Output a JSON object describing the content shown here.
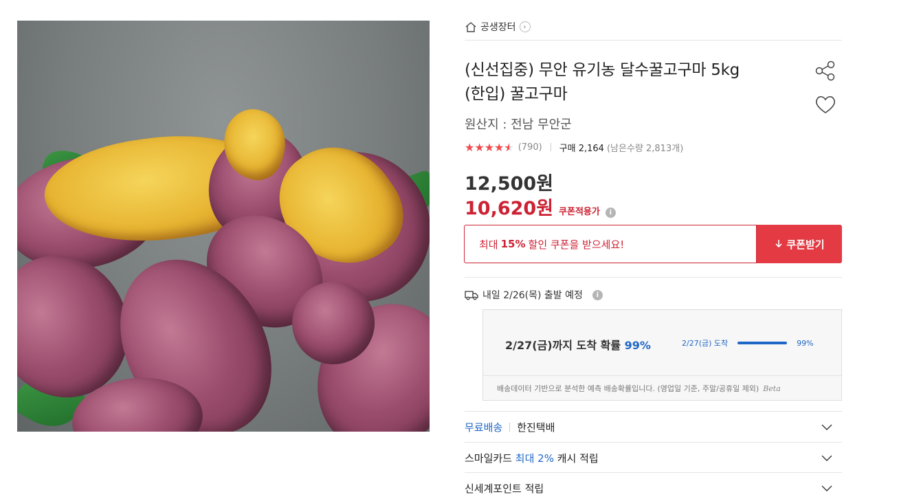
{
  "breadcrumb": {
    "label": "공생장터",
    "icon": "home-icon"
  },
  "product": {
    "title_line1": "(신선집중) 무안 유기농 달수꿀고구마 5kg",
    "title_line2": "(한입) 꿀고구마",
    "origin": "원산지 : 전남 무안군",
    "rating": 4.5,
    "rating_stars": "★★★★★",
    "review_count": "(790)",
    "purchases": "구매 2,164",
    "remaining": "(남은수량 2,813개)",
    "price": "12,500원",
    "sale_price": "10,620원",
    "coupon_applied_label": "쿠폰적용가"
  },
  "coupon": {
    "text_before": "최대",
    "percent": "15%",
    "text_after": "할인 쿠폰을 받으세요!",
    "button_label": "쿠폰받기"
  },
  "shipping": {
    "departure": "내일 2/26(목) 출발 예정",
    "arrival_headline": "2/27(금)까지 도착 확률",
    "arrival_pct": "99%",
    "mini_label": "2/27(금) 도착",
    "mini_pct": "99%",
    "mini_value": 0.99,
    "note": "배송데이터 기반으로 분석한 예측 배송확률입니다. (영업일 기준, 주말/공휴일 제외)",
    "beta": "Beta"
  },
  "accordion": [
    {
      "blue": "무료배송",
      "text": "한진택배"
    },
    {
      "prefix": "스마일카드",
      "blue": "최대 2%",
      "text": "캐시 적립"
    },
    {
      "text": "신세계포인트 적립"
    }
  ],
  "colors": {
    "accent_red": "#cc2233",
    "button_red": "#e33a43",
    "accent_blue": "#1f66c6"
  }
}
